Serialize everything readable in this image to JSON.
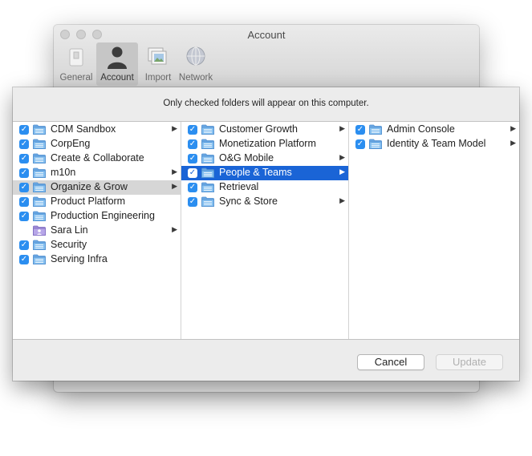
{
  "window": {
    "title": "Account",
    "tabs": [
      {
        "label": "General",
        "icon": "switch-icon",
        "active": false
      },
      {
        "label": "Account",
        "icon": "person-icon",
        "active": true
      },
      {
        "label": "Import",
        "icon": "photos-icon",
        "active": false
      },
      {
        "label": "Network",
        "icon": "globe-icon",
        "active": false
      }
    ]
  },
  "sheet": {
    "message": "Only checked folders will appear on this computer.",
    "columns": [
      [
        {
          "label": "CDM Sandbox",
          "checked": true,
          "arrow": true
        },
        {
          "label": "CorpEng",
          "checked": true,
          "arrow": false
        },
        {
          "label": "Create & Collaborate",
          "checked": true,
          "arrow": false
        },
        {
          "label": "m10n",
          "checked": true,
          "arrow": true
        },
        {
          "label": "Organize & Grow",
          "checked": true,
          "arrow": true,
          "highlight": "grey"
        },
        {
          "label": "Product Platform",
          "checked": true,
          "arrow": false
        },
        {
          "label": "Production Engineering",
          "checked": true,
          "arrow": false
        },
        {
          "label": "Sara Lin",
          "checked": false,
          "arrow": true,
          "special": "user-folder"
        },
        {
          "label": "Security",
          "checked": true,
          "arrow": false
        },
        {
          "label": "Serving Infra",
          "checked": true,
          "arrow": false
        }
      ],
      [
        {
          "label": "Customer Growth",
          "checked": true,
          "arrow": true
        },
        {
          "label": "Monetization Platform",
          "checked": true,
          "arrow": false
        },
        {
          "label": "O&G Mobile",
          "checked": true,
          "arrow": true
        },
        {
          "label": "People & Teams",
          "checked": true,
          "arrow": true,
          "highlight": "blue"
        },
        {
          "label": "Retrieval",
          "checked": true,
          "arrow": false
        },
        {
          "label": "Sync & Store",
          "checked": true,
          "arrow": true
        }
      ],
      [
        {
          "label": "Admin Console",
          "checked": true,
          "arrow": true
        },
        {
          "label": "Identity & Team Model",
          "checked": true,
          "arrow": true
        }
      ]
    ],
    "cancel_label": "Cancel",
    "update_label": "Update"
  },
  "colors": {
    "accent": "#1a64d6",
    "checkbox": "#2b8ef0",
    "folder": "#79b8ec"
  }
}
